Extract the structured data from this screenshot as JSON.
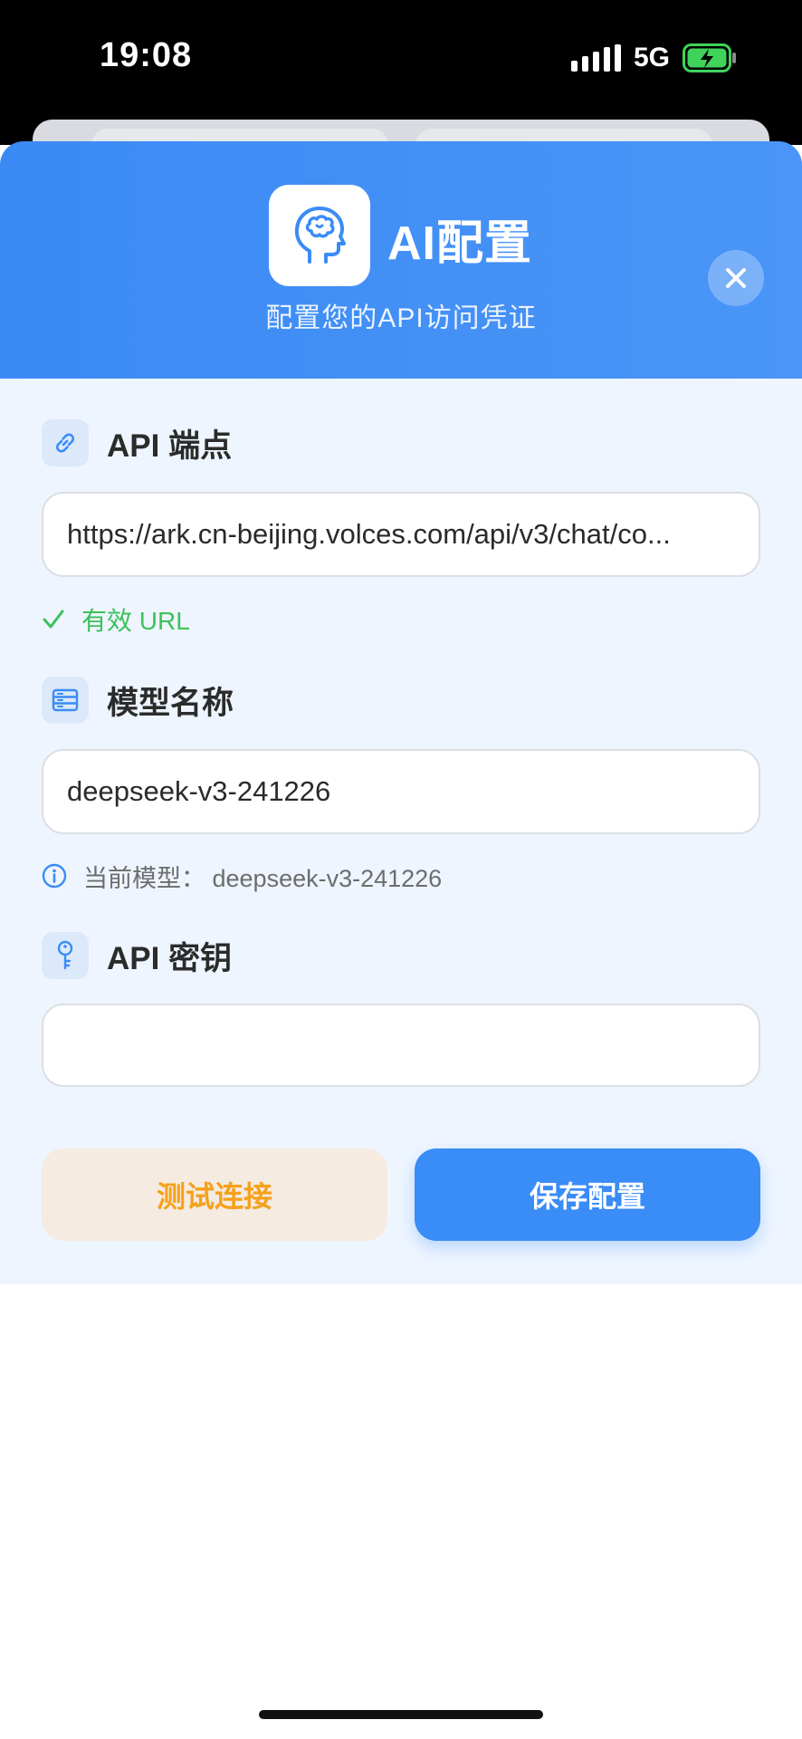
{
  "status_bar": {
    "time": "19:08",
    "network": "5G",
    "icons": [
      "signal-icon",
      "battery-charging-icon"
    ]
  },
  "header": {
    "title": "AI配置",
    "subtitle": "配置您的API访问凭证",
    "icon": "brain-head-icon",
    "close_icon": "close-icon"
  },
  "endpoint": {
    "label": "API 端点",
    "icon": "link-icon",
    "value": "https://ark.cn-beijing.volces.com/api/v3/chat/co...",
    "validation": "有效 URL",
    "validation_icon": "check-icon"
  },
  "model": {
    "label": "模型名称",
    "icon": "server-icon",
    "value": "deepseek-v3-241226",
    "hint": "当前模型： deepseek-v3-241226",
    "hint_icon": "info-icon"
  },
  "api_key": {
    "label": "API 密钥",
    "icon": "key-icon",
    "value": ""
  },
  "actions": {
    "test_label": "测试连接",
    "save_label": "保存配置"
  },
  "colors": {
    "primary": "#3a8cf6",
    "header_gradient_start": "#3b8af4",
    "valid": "#3cc15b",
    "test_button_text": "#f5a11c",
    "test_button_bg": "#f5ebe0",
    "panel_bg": "#eef5ff"
  }
}
